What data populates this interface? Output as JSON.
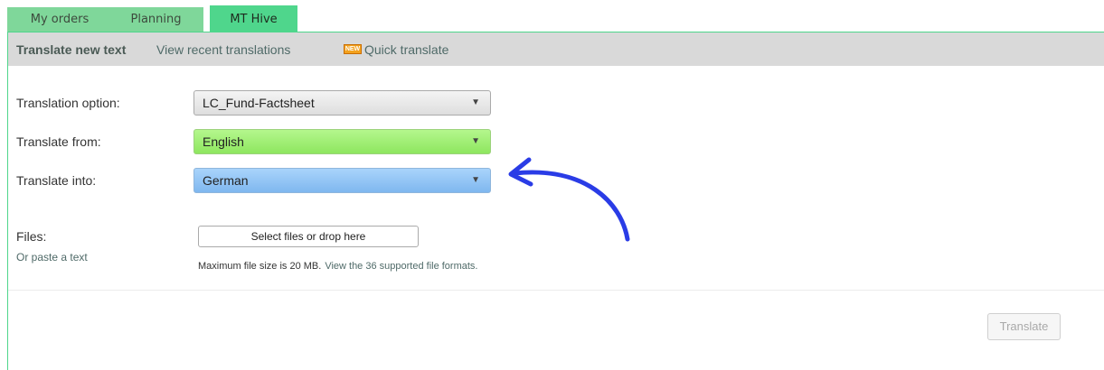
{
  "tabs": [
    {
      "label": "My orders"
    },
    {
      "label": "Planning"
    },
    {
      "label": "MT Hive",
      "active": true
    }
  ],
  "subnav": {
    "translate_new": "Translate new text",
    "view_recent": "View recent translations",
    "new_badge": "NEW",
    "quick_translate": "Quick translate"
  },
  "form": {
    "option_label": "Translation option:",
    "option_value": "LC_Fund-Factsheet",
    "from_label": "Translate from:",
    "from_value": "English",
    "into_label": "Translate into:",
    "into_value": "German",
    "files_label": "Files:",
    "paste_link": "Or paste a text",
    "file_button": "Select files or drop here",
    "max_size": "Maximum file size is 20 MB.",
    "formats_link": "View the 36 supported file formats.",
    "translate_button": "Translate"
  },
  "colors": {
    "tab_active": "#4fd68c",
    "from_select": "#a0ef76",
    "into_select": "#93c5f5",
    "annotation_arrow": "#2a3ce6"
  },
  "icons": {
    "dropdown": "caret-down-icon",
    "annotation": "curved-arrow-icon"
  }
}
